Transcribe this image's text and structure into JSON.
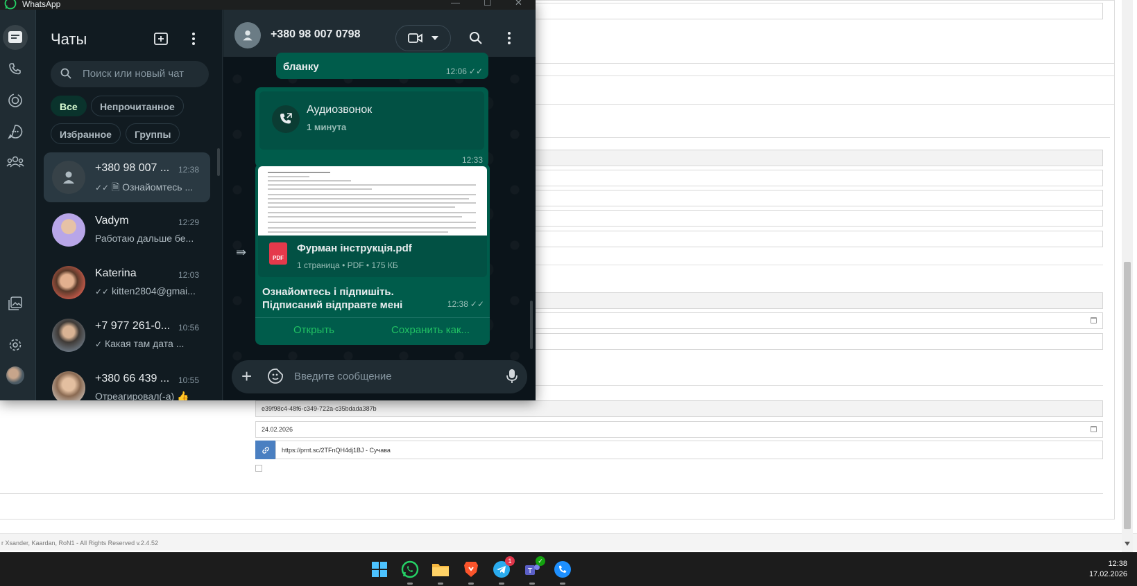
{
  "background_page": {
    "fields": [
      {
        "value": "e39f98c4-48f6-c349-722a-c35bdada387b"
      },
      {
        "value": "24.02.2026"
      },
      {
        "value": "https://prnt.sc/2TFnQH4dj1BJ - Сучава"
      }
    ],
    "footer": "r Xsander, Kaardan, RoN1 - All Rights Reserved v.2.4.52"
  },
  "taskbar": {
    "time": "12:38",
    "date": "17.02.2026",
    "telegram_badge": "1"
  },
  "whatsapp": {
    "window_title": "WhatsApp",
    "chat_list": {
      "title": "Чаты",
      "search_placeholder": "Поиск или новый чат",
      "filters": [
        "Все",
        "Непрочитанное",
        "Избранное",
        "Группы"
      ],
      "chats": [
        {
          "name": "+380 98 007 ...",
          "time": "12:38",
          "preview": "Ознайомтесь ..."
        },
        {
          "name": "Vadym",
          "time": "12:29",
          "preview": "Работаю дальше бе..."
        },
        {
          "name": "Katerina",
          "time": "12:03",
          "preview": "kitten2804@gmai..."
        },
        {
          "name": "+7 977 261-0...",
          "time": "10:56",
          "preview": "Какая там дата ..."
        },
        {
          "name": "+380 66 439 ...",
          "time": "10:55",
          "preview": "Отреагировал(-а) 👍"
        }
      ]
    },
    "conversation": {
      "contact": "+380 98 007 0798",
      "messages": {
        "m1_text": "бланку",
        "m1_time": "12:06",
        "call_title": "Аудиозвонок",
        "call_duration": "1 минута",
        "call_time": "12:33",
        "pdf_name": "Фурман інструкція.pdf",
        "pdf_meta": "1 страница • PDF • 175 КБ",
        "pdf_badge": "PDF",
        "caption_line1": "Ознайомтесь і підпишіть.",
        "caption_line2": "Підписаний відправте мені",
        "doc_time": "12:38",
        "open_label": "Открыть",
        "save_label": "Сохранить как..."
      },
      "composer_placeholder": "Введите сообщение"
    },
    "colors": {
      "accent": "#21c063",
      "bubble_out": "#005c4b",
      "panel": "#202c33",
      "bg": "#111b21"
    }
  }
}
